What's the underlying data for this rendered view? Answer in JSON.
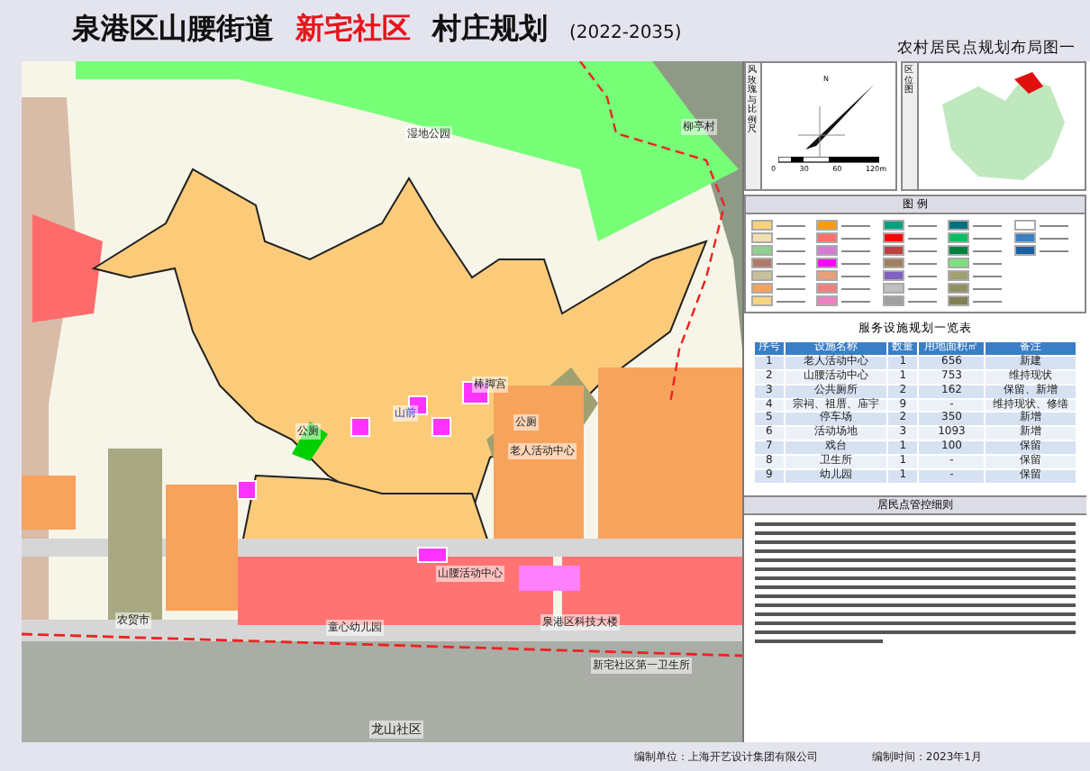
{
  "header": {
    "title_parts": [
      {
        "text": "泉港区山腰街道",
        "highlight": false
      },
      {
        "text": "新宅社区",
        "highlight": true
      },
      {
        "text": "村庄规划",
        "highlight": false
      }
    ],
    "years": "(2022-2035)",
    "subtitle": "农村居民点规划布局图一"
  },
  "map": {
    "labels": [
      "湿地公园",
      "柳亭村",
      "公厕",
      "山前",
      "棒脚宫",
      "公厕",
      "老人活动中心",
      "山腰活动中心",
      "童心幼儿园",
      "泉港区科技大楼",
      "新宅社区第一卫生所",
      "农贸市",
      "龙山社区"
    ]
  },
  "insets": {
    "wind_label": "风玫瑰与比例尺",
    "north": "N",
    "scale_ticks": [
      "0",
      "30",
      "60",
      "120m"
    ],
    "location_label": "区位图"
  },
  "legend": {
    "title": "图 例"
  },
  "facility_table": {
    "title": "服务设施规划一览表",
    "columns": [
      "序号",
      "设施名称",
      "数量",
      "用地面积㎡",
      "备注"
    ],
    "rows": [
      [
        "1",
        "老人活动中心",
        "1",
        "656",
        "新建"
      ],
      [
        "2",
        "山腰活动中心",
        "1",
        "753",
        "维持现状"
      ],
      [
        "3",
        "公共厕所",
        "2",
        "162",
        "保留、新增"
      ],
      [
        "4",
        "宗祠、祖厝、庙宇",
        "9",
        "-",
        "维持现状、修缮"
      ],
      [
        "5",
        "停车场",
        "2",
        "350",
        "新增"
      ],
      [
        "6",
        "活动场地",
        "3",
        "1093",
        "新增"
      ],
      [
        "7",
        "戏台",
        "1",
        "100",
        "保留"
      ],
      [
        "8",
        "卫生所",
        "1",
        "-",
        "保留"
      ],
      [
        "9",
        "幼儿园",
        "1",
        "-",
        "保留"
      ]
    ]
  },
  "rules": {
    "title": "居民点管控细则"
  },
  "footer": {
    "unit": "编制单位：上海开艺设计集团有限公司",
    "date": "编制时间：2023年1月"
  }
}
